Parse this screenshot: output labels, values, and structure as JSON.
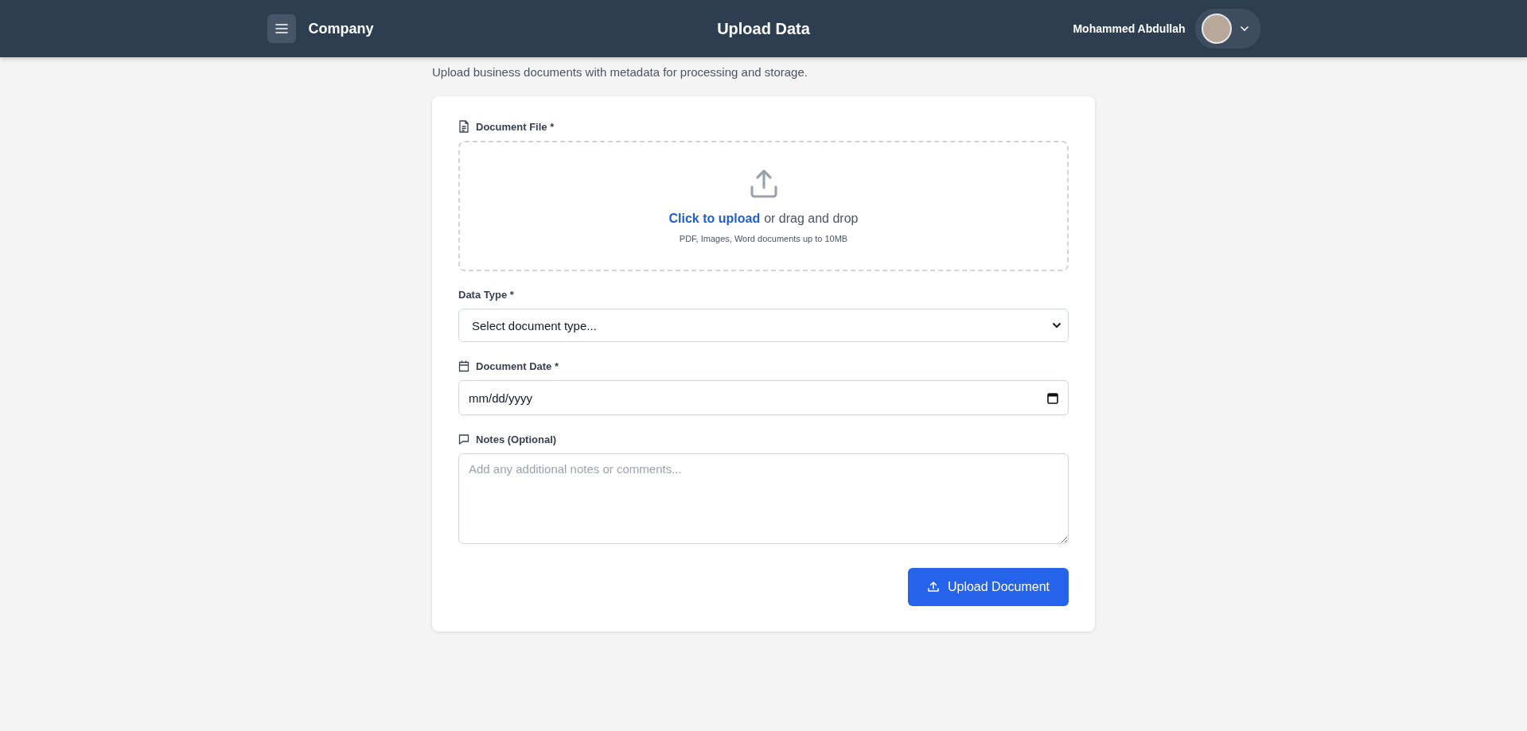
{
  "header": {
    "brand": "Company",
    "title": "Upload Data",
    "user": {
      "name": "Mohammed Abdullah"
    }
  },
  "subtitle": "Upload business documents with metadata for processing and storage.",
  "fields": [
    {
      "kind": "file",
      "label": "Document File *",
      "link": "Click to upload",
      "text": "or drag and drop",
      "hint": "PDF, Images, Word documents up to 10MB"
    },
    {
      "kind": "select",
      "label": "Data Type *",
      "value": "Select document type..."
    },
    {
      "kind": "date",
      "label": "Document Date *",
      "placeholder": "mm/dd/yyyy"
    },
    {
      "kind": "textarea",
      "label": "Notes (Optional)",
      "placeholder": "Add any additional notes or comments..."
    }
  ],
  "submit": {
    "label": "Upload Document"
  }
}
